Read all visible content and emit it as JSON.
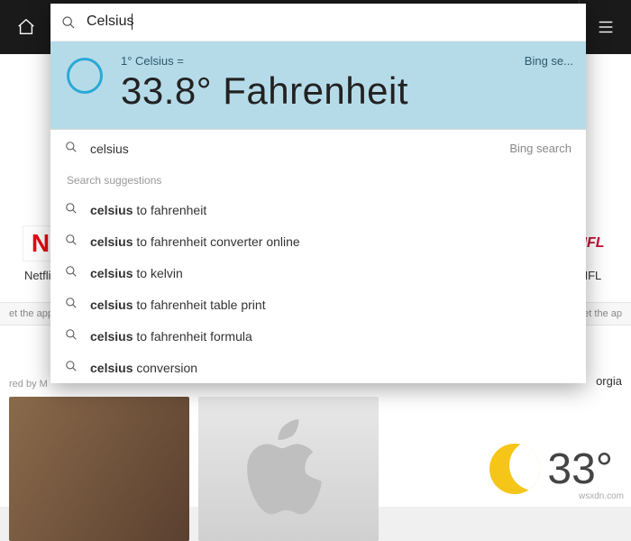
{
  "toolbar": {},
  "search": {
    "query": "Celsius",
    "answer_query": "1° Celsius =",
    "answer_result": "33.8° Fahrenheit",
    "answer_provider": "Bing se...",
    "top_suggestion": "celsius",
    "top_provider": "Bing search",
    "section_label": "Search suggestions",
    "suggestions": [
      {
        "bold": "celsius",
        "rest": " to fahrenheit"
      },
      {
        "bold": "celsius",
        "rest": " to fahrenheit converter online"
      },
      {
        "bold": "celsius",
        "rest": " to kelvin"
      },
      {
        "bold": "celsius",
        "rest": " to fahrenheit table print"
      },
      {
        "bold": "celsius",
        "rest": " to fahrenheit formula"
      },
      {
        "bold": "celsius",
        "rest": " conversion"
      }
    ]
  },
  "tiles": {
    "left": {
      "icon": "N",
      "label": "Netflix",
      "sub": "et the app"
    },
    "right": {
      "icon": "NFL",
      "label": "NFL",
      "sub": "et the ap"
    }
  },
  "footer": {
    "powered": "red by M",
    "geo": "orgia",
    "temperature": "33°"
  },
  "watermark": "wsxdn.com"
}
